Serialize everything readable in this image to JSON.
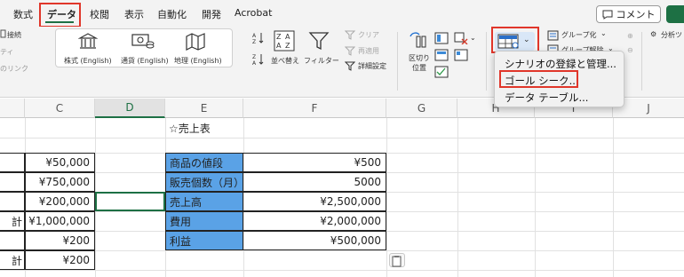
{
  "ribbon": {
    "tabs": [
      "数式",
      "データ",
      "校閲",
      "表示",
      "自動化",
      "開発",
      "Acrobat"
    ],
    "active_tab": "データ",
    "comment_label": "コメント",
    "left_partial": [
      "接続",
      "ティ",
      "のリンク"
    ],
    "data_types": [
      "株式 (English)",
      "通貨 (English)",
      "地理 (English)"
    ],
    "sort_label": "並べ替え",
    "filter_label": "フィルター",
    "clear_label": "クリア",
    "reapply_label": "再適用",
    "advanced_label": "詳細設定",
    "split_label_1": "区切り",
    "split_label_2": "位置",
    "group_label": "グループ化",
    "ungroup_label": "グループ解除",
    "analysis_label": "分析ツ"
  },
  "dropdown": {
    "items": [
      "シナリオの登録と管理...",
      "ゴール シーク...",
      "データ テーブル..."
    ],
    "highlighted": "ゴール シーク..."
  },
  "grid": {
    "columns": [
      "C",
      "D",
      "E",
      "F",
      "G",
      "H",
      "I",
      "J"
    ],
    "selected_column": "D",
    "col_c": [
      "",
      "",
      "¥50,000",
      "¥750,000",
      "¥200,000",
      "¥1,000,000",
      "¥200",
      "¥200"
    ],
    "col_b_partial": [
      "計",
      "計"
    ],
    "title_cell": "☆売上表",
    "table": [
      {
        "label": "商品の値段",
        "value": "¥500"
      },
      {
        "label": "販売個数（月）",
        "value": "5000"
      },
      {
        "label": "売上高",
        "value": "¥2,500,000"
      },
      {
        "label": "費用",
        "value": "¥2,000,000"
      },
      {
        "label": "利益",
        "value": "¥500,000"
      }
    ]
  },
  "colors": {
    "accent_green": "#1d7044",
    "highlight_red": "#e0362a",
    "label_blue": "#5aa2e6"
  }
}
